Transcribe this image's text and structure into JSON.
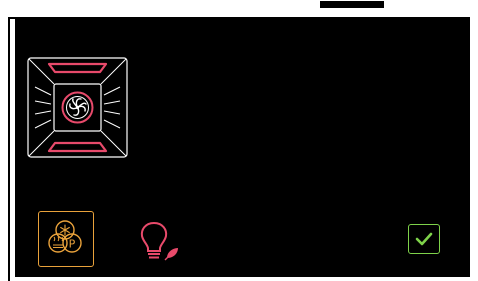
{
  "colors": {
    "background": "#000000",
    "frame": "#ffffff",
    "heating_element": "#e84a6b",
    "fan_ring": "#e84a6b",
    "mode_button_accent": "#e9a23b",
    "eco_bulb": "#e84a6b",
    "eco_leaf": "#e84a6b",
    "confirm_accent": "#7ed24a"
  },
  "oven_diagram": {
    "icon": "oven-fan-top-bottom-heat-icon",
    "top_heat": true,
    "bottom_heat": true,
    "fan": true
  },
  "mode_button": {
    "icon": "fan-plus-pyrolysis-mode-icon",
    "letter": "P"
  },
  "eco_light": {
    "icon": "eco-light-bulb-icon"
  },
  "confirm": {
    "icon": "checkmark-icon"
  }
}
